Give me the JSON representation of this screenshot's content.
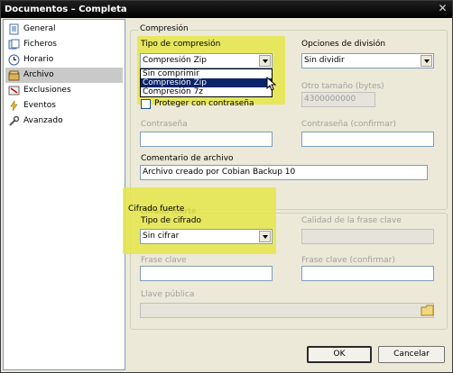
{
  "window": {
    "title": "Documentos – Completa",
    "close_glyph": "✕"
  },
  "sidebar": {
    "items": [
      {
        "label": "General",
        "icon": "document-icon",
        "selected": false
      },
      {
        "label": "Ficheros",
        "icon": "files-icon",
        "selected": false
      },
      {
        "label": "Horario",
        "icon": "clock-icon",
        "selected": false
      },
      {
        "label": "Archivo",
        "icon": "archive-icon",
        "selected": true
      },
      {
        "label": "Exclusiones",
        "icon": "exclusions-icon",
        "selected": false
      },
      {
        "label": "Eventos",
        "icon": "events-icon",
        "selected": false
      },
      {
        "label": "Avanzado",
        "icon": "advanced-icon",
        "selected": false
      }
    ]
  },
  "compression": {
    "group_label": "Compresión",
    "type_label": "Tipo de compresión",
    "type_value": "Compresión Zip",
    "type_options": [
      "Sin comprimir",
      "Compresión Zip",
      "Compresión 7z"
    ],
    "type_selected_index": 1,
    "split_label": "Opciones de división",
    "split_value": "Sin dividir",
    "size_label": "Otro tamaño (bytes)",
    "size_value": "4300000000",
    "protect_label": "Proteger con contraseña",
    "protect_checked": false,
    "password_label": "Contraseña",
    "password_value": "",
    "password_confirm_label": "Contraseña (confirmar)",
    "password_confirm_value": "",
    "comment_label": "Comentario de archivo",
    "comment_value": "Archivo creado por Cobian Backup 10"
  },
  "encryption": {
    "group_label": "Cifrado fuerte",
    "type_label": "Tipo de cifrado",
    "type_value": "Sin cifrar",
    "quality_label": "Calidad de la frase clave",
    "passphrase_label": "Frase clave",
    "passphrase_value": "",
    "passphrase_confirm_label": "Frase clave (confirmar)",
    "passphrase_confirm_value": "",
    "public_key_label": "Llave pública",
    "public_key_value": ""
  },
  "buttons": {
    "ok": "OK",
    "cancel": "Cancelar"
  },
  "colors": {
    "highlight": "#e6e64a",
    "selection": "#0a246a",
    "titlebar": "#000000"
  }
}
